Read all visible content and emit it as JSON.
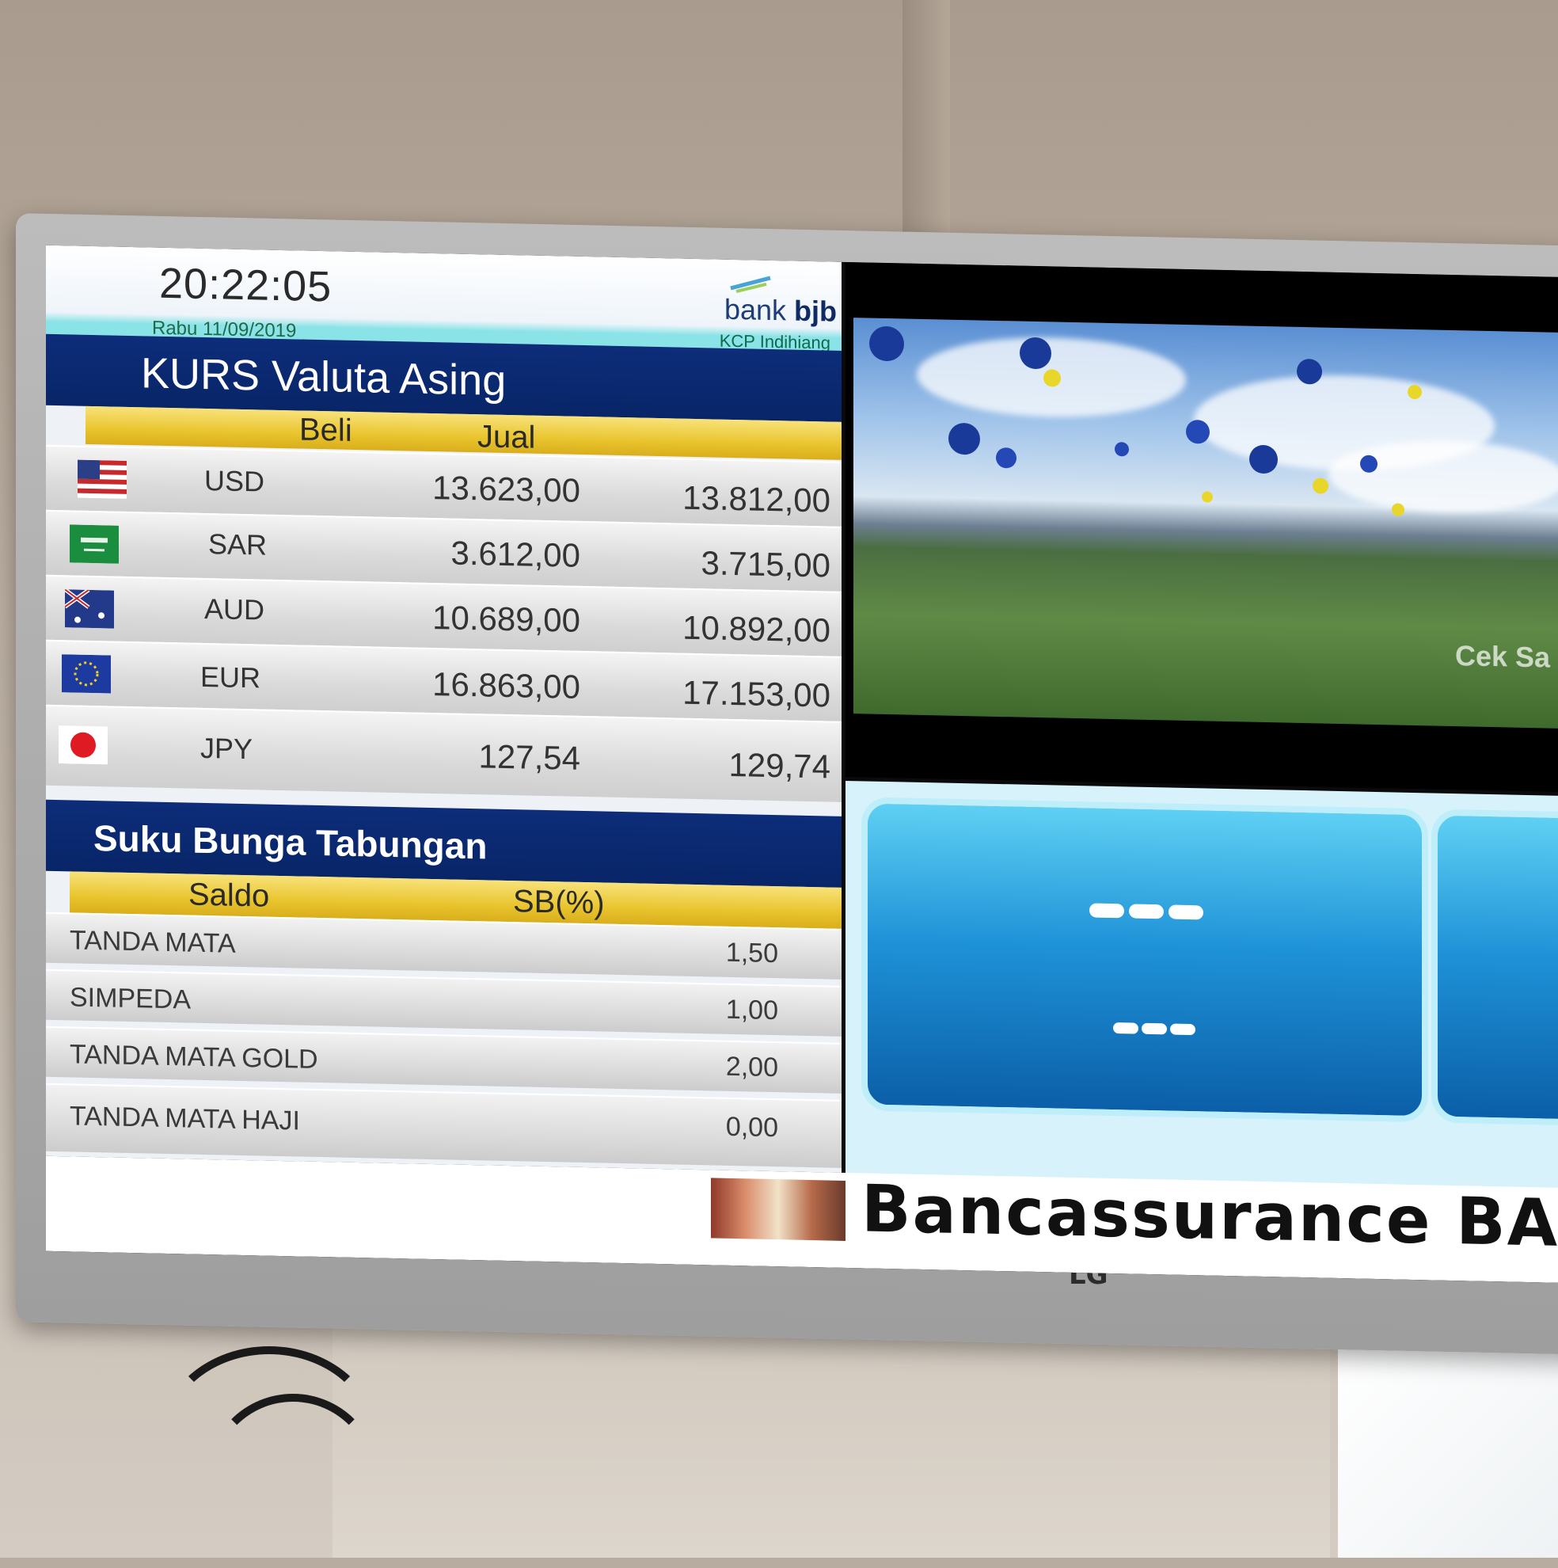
{
  "screen": {
    "clock": "20:22:05",
    "date": "Rabu 11/09/2019",
    "bank_name_prefix": "bank ",
    "bank_name_bold": "bjb",
    "branch": "KCP Indihiang"
  },
  "kurs": {
    "title": "KURS Valuta Asing",
    "col_buy": "Beli",
    "col_sell": "Jual",
    "rows": [
      {
        "currency": "USD",
        "buy": "13.623,00",
        "sell": "13.812,00",
        "flag": "usa-flag-icon"
      },
      {
        "currency": "SAR",
        "buy": "3.612,00",
        "sell": "3.715,00",
        "flag": "saudi-flag-icon"
      },
      {
        "currency": "AUD",
        "buy": "10.689,00",
        "sell": "10.892,00",
        "flag": "australia-flag-icon"
      },
      {
        "currency": "EUR",
        "buy": "16.863,00",
        "sell": "17.153,00",
        "flag": "eu-flag-icon"
      },
      {
        "currency": "JPY",
        "buy": "127,54",
        "sell": "129,74",
        "flag": "japan-flag-icon"
      }
    ]
  },
  "savings": {
    "title": "Suku Bunga Tabungan",
    "col_balance": "Saldo",
    "col_rate": "SB(%)",
    "rows": [
      {
        "label": "TANDA MATA",
        "rate": "1,50"
      },
      {
        "label": "SIMPEDA",
        "rate": "1,00"
      },
      {
        "label": "TANDA MATA GOLD",
        "rate": "2,00"
      },
      {
        "label": "TANDA MATA HAJI",
        "rate": "0,00"
      }
    ]
  },
  "video": {
    "caption": "Cek Sa"
  },
  "ticker": {
    "text": "Bancassurance  BAH"
  },
  "tv": {
    "brand": "LG"
  }
}
